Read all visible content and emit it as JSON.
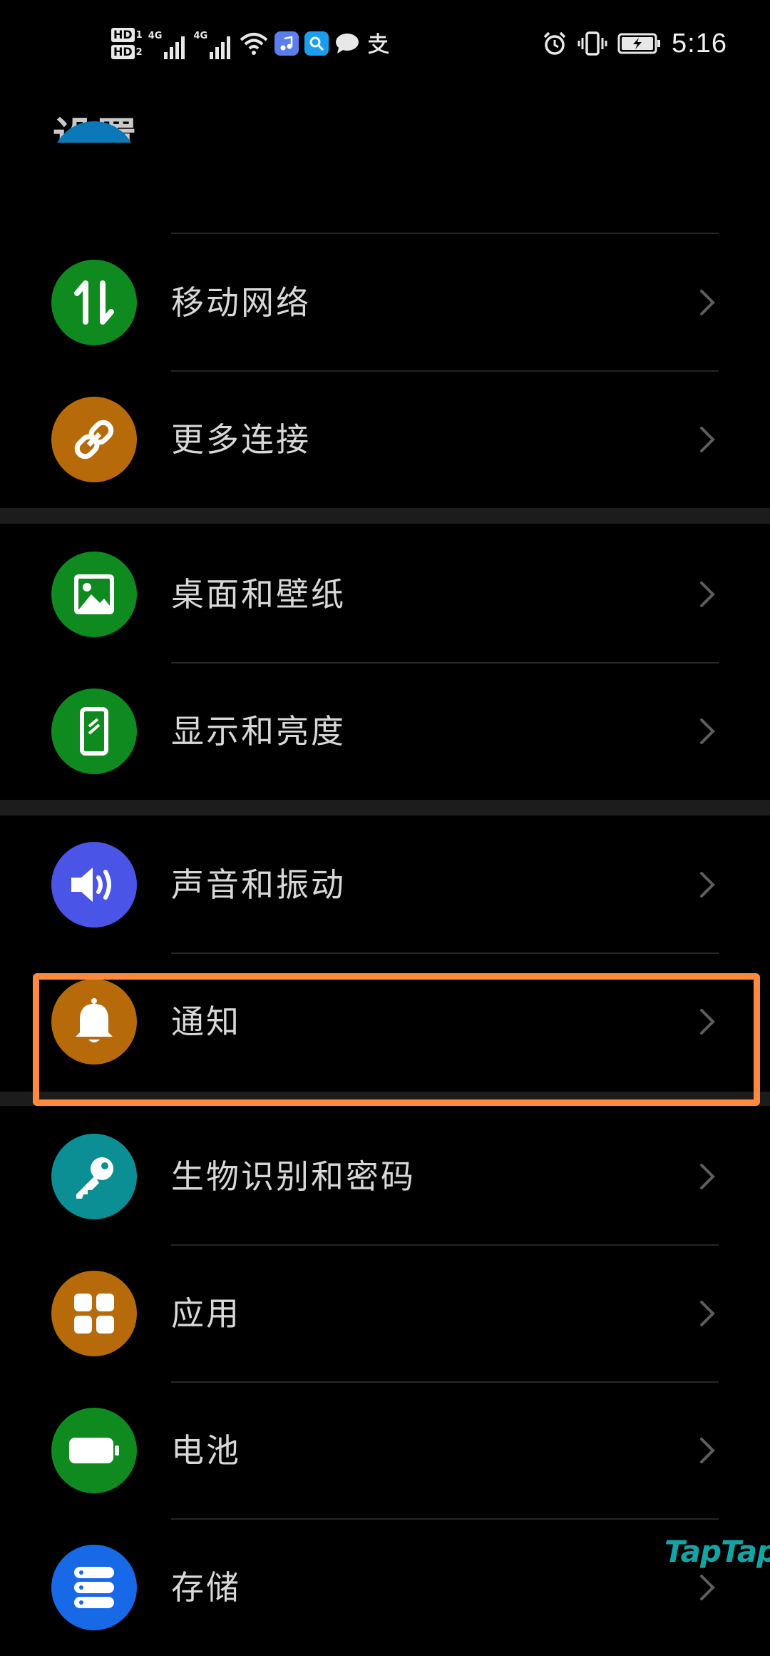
{
  "status_bar": {
    "hd1": "HD",
    "hd1_num": "1",
    "hd2": "HD",
    "hd2_num": "2",
    "sim1_gen": "4G",
    "sim2_gen": "4G",
    "time": "5:16",
    "icons": [
      "signal-icon",
      "wifi-icon",
      "music-app-icon",
      "search-app-icon",
      "chat-icon",
      "alipay-icon",
      "alarm-icon",
      "vibrate-icon",
      "battery-charging-icon"
    ]
  },
  "title": "设置",
  "colors": {
    "background": "#000000",
    "divider": "#262626",
    "section_gap": "#1c1c1c",
    "highlight": "#ff8a3d",
    "watermark": "#15a4a6"
  },
  "items": [
    {
      "label": "移动网络",
      "icon": "mobile-data-icon",
      "color": "#0f8a1f"
    },
    {
      "label": "更多连接",
      "icon": "link-icon",
      "color": "#b76a0a"
    },
    {
      "label": "桌面和壁纸",
      "icon": "image-icon",
      "color": "#0f8a1f"
    },
    {
      "label": "显示和亮度",
      "icon": "phone-display-icon",
      "color": "#0f8a1f"
    },
    {
      "label": "声音和振动",
      "icon": "speaker-icon",
      "color": "#4a55e8"
    },
    {
      "label": "通知",
      "icon": "bell-icon",
      "color": "#b76a0a"
    },
    {
      "label": "生物识别和密码",
      "icon": "key-icon",
      "color": "#0b8f95"
    },
    {
      "label": "应用",
      "icon": "apps-grid-icon",
      "color": "#b76a0a"
    },
    {
      "label": "电池",
      "icon": "battery-icon",
      "color": "#0f8a1f"
    },
    {
      "label": "存储",
      "icon": "storage-icon",
      "color": "#1869e8"
    }
  ],
  "watermark": "TapTap"
}
